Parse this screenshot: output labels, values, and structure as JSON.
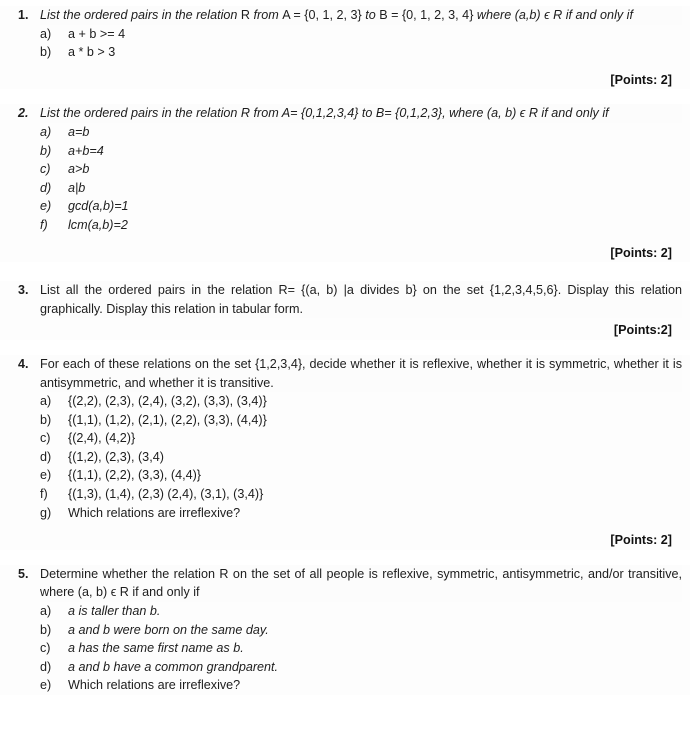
{
  "document": {
    "clipped_header_text": "..... ..... ... ...... ...... ....... ......... ... ..... ..... ....... ... ........... ."
  },
  "questions": [
    {
      "number": "1.",
      "number_style": "bold",
      "stem_parts": [
        {
          "text": "List the ordered pairs in the relation ",
          "style": "italic"
        },
        {
          "text": "R",
          "style": "upright"
        },
        {
          "text": " from ",
          "style": "italic"
        },
        {
          "text": "A = {0, 1, 2, 3}",
          "style": "upright"
        },
        {
          "text": " to ",
          "style": "italic"
        },
        {
          "text": "B = {0, 1, 2, 3, 4}",
          "style": "upright"
        },
        {
          "text": " where (a,b) ϵ R ",
          "style": "italic"
        },
        {
          "text": "if and only if",
          "style": "italic"
        }
      ],
      "stem_plain": "List the ordered pairs in the relation R from A = {0, 1, 2, 3} to B = {0, 1, 2, 3, 4} where (a,b) ϵ R if and only if",
      "items": [
        {
          "letter": "a)",
          "text": "a + b >= 4",
          "style": "upright"
        },
        {
          "letter": "b)",
          "text": "a * b > 3",
          "style": "upright"
        }
      ],
      "points": "[Points: 2]"
    },
    {
      "number": "2.",
      "number_style": "bold-italic",
      "stem_plain": "List the ordered pairs in the relation R from A= {0,1,2,3,4} to B= {0,1,2,3}, where (a, b) ϵ R if and only if",
      "items": [
        {
          "letter": "a)",
          "text": "a=b",
          "style": "italic"
        },
        {
          "letter": "b)",
          "text": "a+b=4",
          "style": "italic"
        },
        {
          "letter": "c)",
          "text": "a>b",
          "style": "italic"
        },
        {
          "letter": "d)",
          "text": "a|b",
          "style": "italic"
        },
        {
          "letter": "e)",
          "text": "gcd(a,b)=1",
          "style": "italic"
        },
        {
          "letter": "f)",
          "text": "lcm(a,b)=2",
          "style": "italic"
        }
      ],
      "points": "[Points: 2]"
    },
    {
      "number": "3.",
      "number_style": "bold",
      "stem_plain": "List all the ordered pairs in the relation R= {(a, b) |a divides b} on the set {1,2,3,4,5,6}. Display this relation graphically. Display this relation in tabular form.",
      "items": [],
      "points": "[Points:2]"
    },
    {
      "number": "4.",
      "number_style": "bold",
      "stem_plain": "For each of these relations on the set {1,2,3,4}, decide whether it is reflexive, whether it is symmetric, whether it is antisymmetric, and whether it is transitive.",
      "items": [
        {
          "letter": "a)",
          "text": "{(2,2), (2,3), (2,4), (3,2), (3,3), (3,4)}",
          "style": "upright"
        },
        {
          "letter": "b)",
          "text": "{(1,1), (1,2), (2,1), (2,2), (3,3), (4,4)}",
          "style": "upright"
        },
        {
          "letter": "c)",
          "text": "{(2,4), (4,2)}",
          "style": "upright"
        },
        {
          "letter": "d)",
          "text": "{(1,2), (2,3), (3,4)",
          "style": "upright"
        },
        {
          "letter": "e)",
          "text": "{(1,1), (2,2), (3,3), (4,4)}",
          "style": "upright"
        },
        {
          "letter": "f)",
          "text": "{(1,3), (1,4), (2,3) (2,4), (3,1), (3,4)}",
          "style": "upright"
        },
        {
          "letter": "g)",
          "text": "Which relations are irreflexive?",
          "style": "upright"
        }
      ],
      "points": "[Points: 2]"
    },
    {
      "number": "5.",
      "number_style": "bold",
      "stem_plain": "Determine whether the relation R on the set of all people is reflexive, symmetric, antisymmetric, and/or transitive, where (a, b) ϵ R if and only if",
      "items": [
        {
          "letter": "a)",
          "text": "a is taller than b.",
          "style": "mixed"
        },
        {
          "letter": "b)",
          "text": "a and b were born on the same day.",
          "style": "mixed"
        },
        {
          "letter": "c)",
          "text": "a has the same first name as b.",
          "style": "mixed"
        },
        {
          "letter": "d)",
          "text": "a and b have a common grandparent.",
          "style": "mixed"
        },
        {
          "letter": "e)",
          "text": "Which relations are irreflexive?",
          "style": "upright"
        }
      ],
      "points": ""
    }
  ]
}
